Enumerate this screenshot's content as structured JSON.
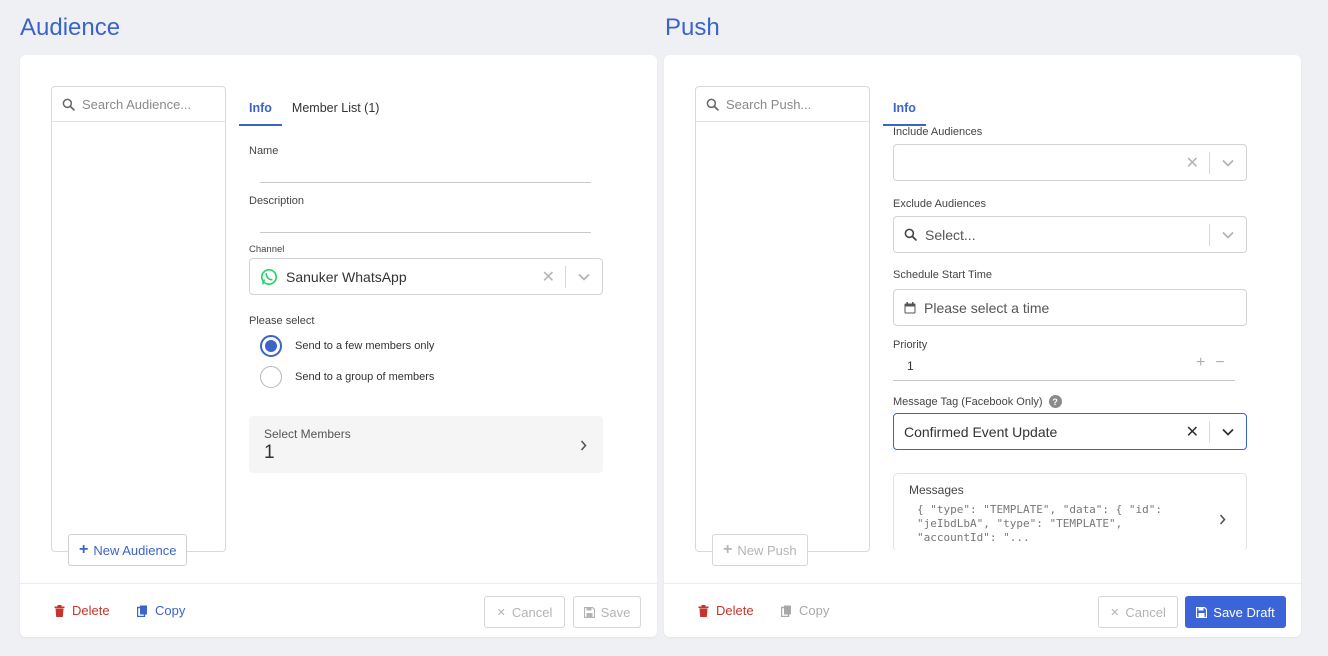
{
  "audience": {
    "title": "Audience",
    "search_placeholder": "Search Audience...",
    "new_button": "New Audience",
    "tabs": [
      {
        "label": "Info",
        "active": true
      },
      {
        "label": "Member List (1)",
        "active": false
      }
    ],
    "name_label": "Name",
    "description_label": "Description",
    "channel_label": "Channel",
    "channel_value": "Sanuker WhatsApp",
    "please_select_label": "Please select",
    "radio_options": [
      {
        "label": "Send to a few members only",
        "selected": true
      },
      {
        "label": "Send to a group of members",
        "selected": false
      }
    ],
    "select_members_label": "Select Members",
    "select_members_count": "1",
    "footer": {
      "delete": "Delete",
      "copy": "Copy",
      "cancel": "Cancel",
      "save": "Save"
    }
  },
  "push": {
    "title": "Push",
    "search_placeholder": "Search Push...",
    "new_button": "New Push",
    "tabs": [
      {
        "label": "Info",
        "active": true
      }
    ],
    "include_label": "Include Audiences",
    "exclude_label": "Exclude Audiences",
    "exclude_placeholder": "Select...",
    "schedule_label": "Schedule Start Time",
    "schedule_placeholder": "Please select a time",
    "priority_label": "Priority",
    "priority_value": "1",
    "message_tag_label": "Message Tag (Facebook Only)",
    "message_tag_value": "Confirmed Event Update",
    "messages_label": "Messages",
    "messages_preview": "{ \"type\": \"TEMPLATE\", \"data\": { \"id\":\n\"jeIbdLbA\", \"type\": \"TEMPLATE\",\n\"accountId\": \"...",
    "footer": {
      "delete": "Delete",
      "copy": "Copy",
      "cancel": "Cancel",
      "save_draft": "Save Draft"
    }
  },
  "colors": {
    "accent": "#3c63c8",
    "danger": "#c8342b",
    "whatsapp": "#25d366"
  }
}
